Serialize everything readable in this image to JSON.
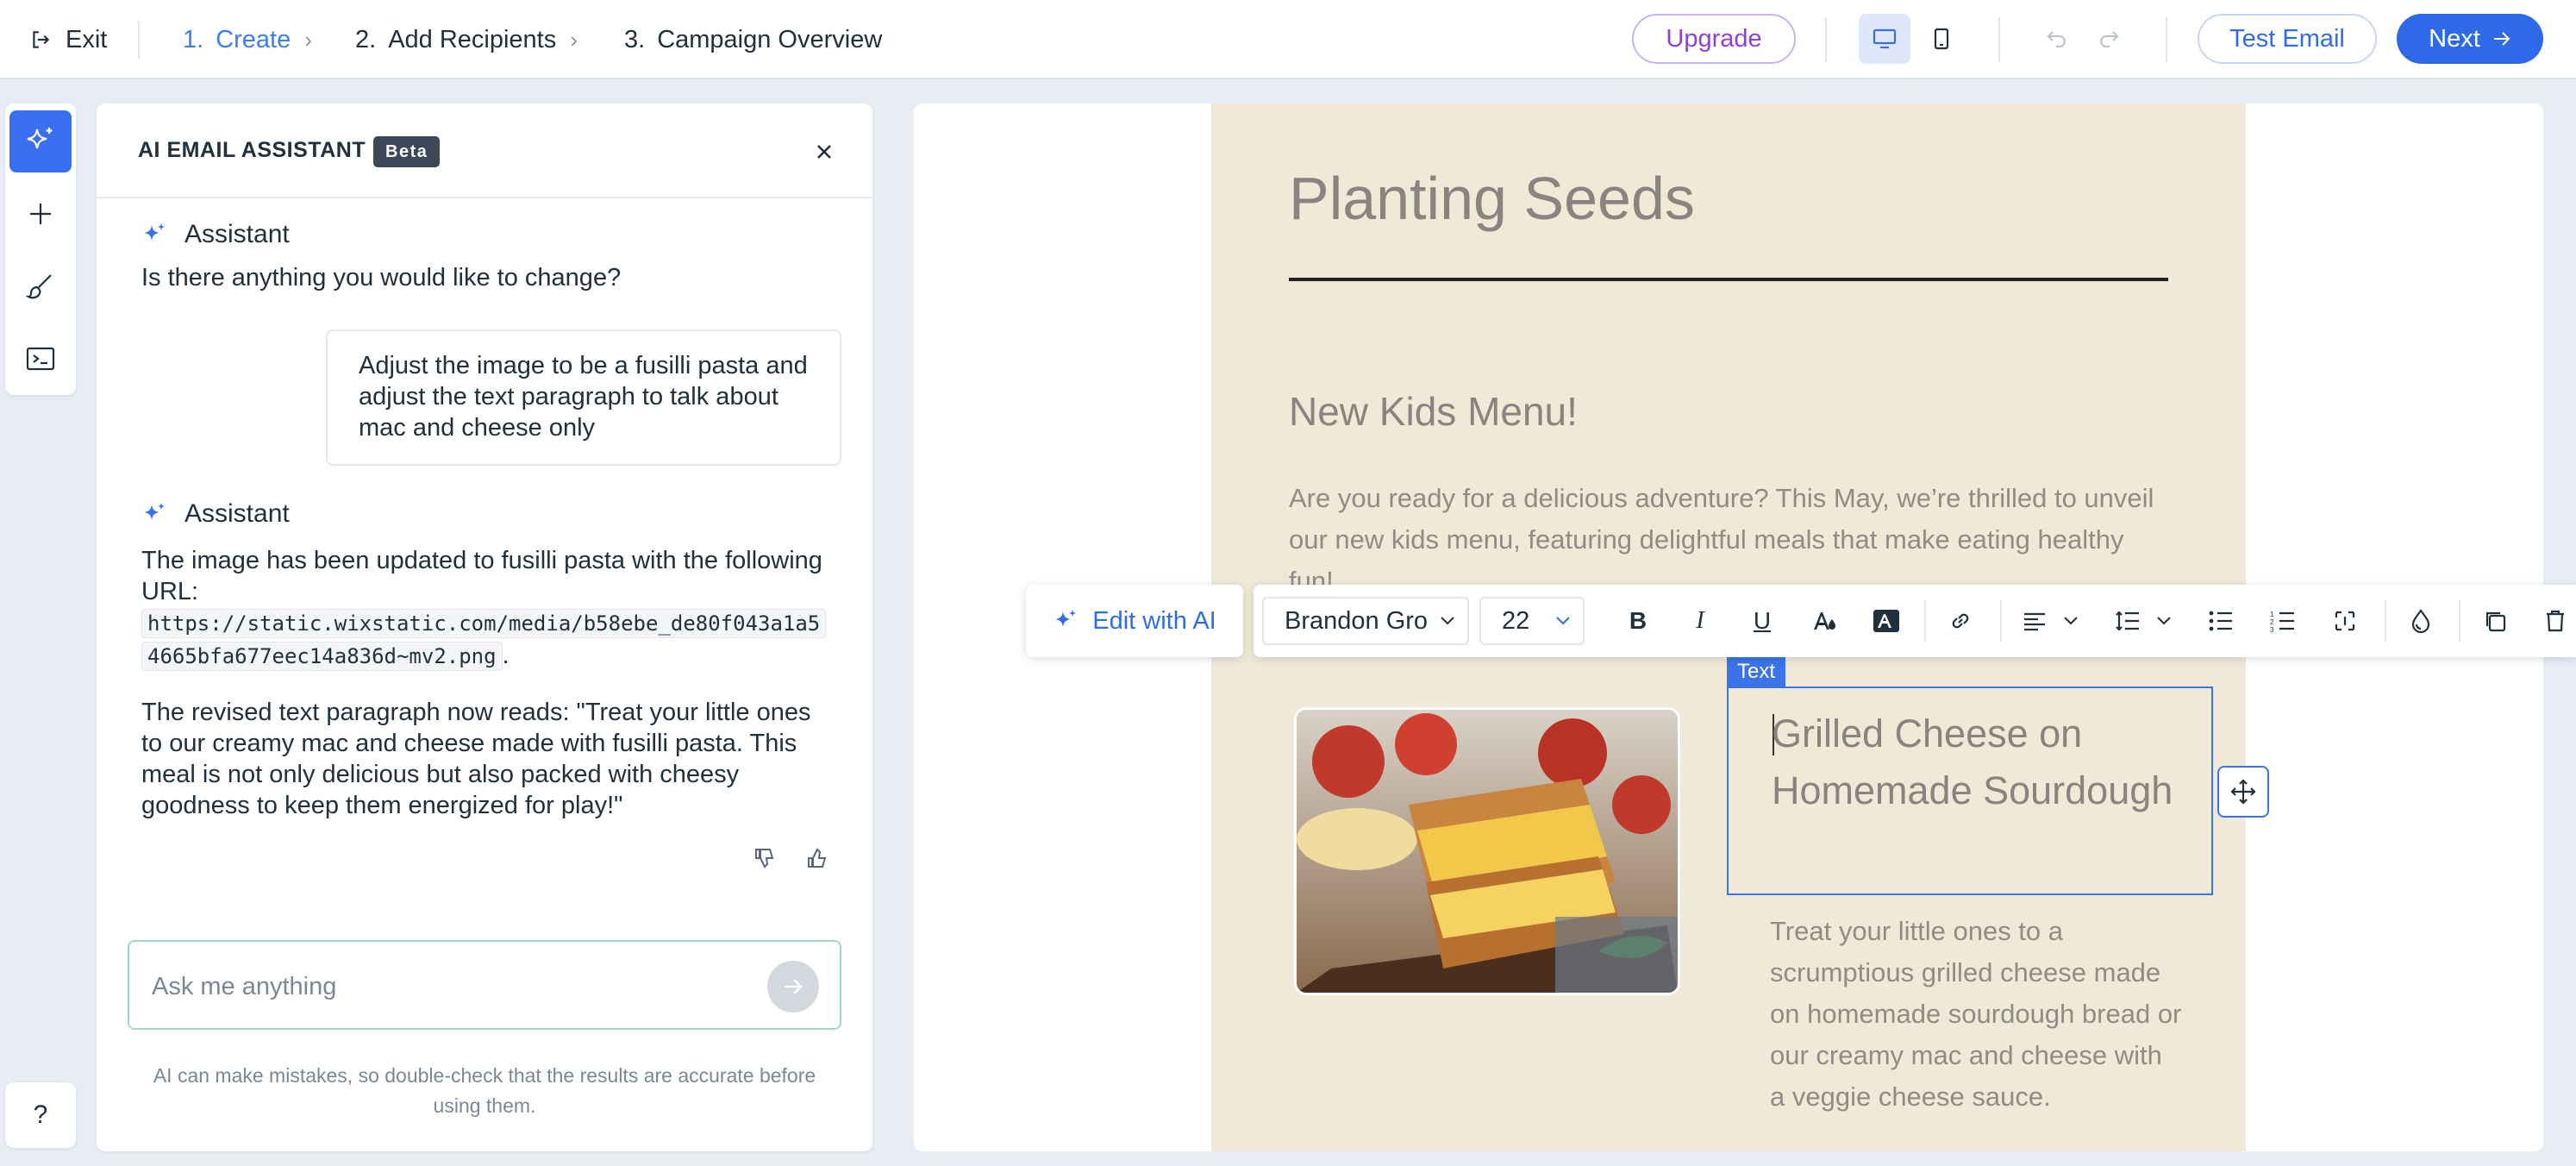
{
  "topbar": {
    "exit_label": "Exit",
    "steps": [
      {
        "num": "1.",
        "label": "Create"
      },
      {
        "num": "2.",
        "label": "Add Recipients"
      },
      {
        "num": "3.",
        "label": "Campaign Overview"
      }
    ],
    "upgrade_label": "Upgrade",
    "test_email_label": "Test Email",
    "next_label": "Next"
  },
  "panel": {
    "title": "AI EMAIL ASSISTANT",
    "badge": "Beta",
    "messages": {
      "assistant_name": "Assistant",
      "assistant_1": "Is there anything you would like to change?",
      "user_1": "Adjust the image to be a fusilli pasta and adjust the text paragraph to talk about mac and cheese only",
      "assistant_2_intro": "The image has been updated to fusilli pasta with the following URL:",
      "assistant_2_url_line1": "https://static.wixstatic.com/media/b58ebe_de80f043a1a5",
      "assistant_2_url_line2": "4665bfa677eec14a836d~mv2.png",
      "assistant_2_period": ".",
      "assistant_3": "The revised text paragraph now reads: \"Treat your little ones to our creamy mac and cheese made with fusilli pasta. This meal is not only delicious but also packed with cheesy goodness to keep them energized for play!\""
    },
    "input_placeholder": "Ask me anything",
    "disclaimer": "AI can make mistakes, so double-check that the results are accurate before using them."
  },
  "email": {
    "title": "Planting Seeds",
    "subtitle": "New Kids Menu!",
    "paragraph": "Are you ready for a delicious adventure? This May, we’re thrilled to unveil our new kids menu, featuring delightful meals that make eating healthy fun!",
    "text_badge": "Text",
    "item_title": "Grilled Cheese on Homemade Sourdough",
    "item_desc": "Treat your little ones to a scrumptious grilled cheese made on homemade sourdough bread or our creamy mac and cheese with a veggie cheese sauce."
  },
  "toolbar": {
    "edit_ai_label": "Edit with AI",
    "font": "Brandon Gro",
    "font_size": "22"
  },
  "colors": {
    "accent": "#2e69e8",
    "email_bg": "#f1e9d7",
    "upgrade_purple": "#8f3fe0"
  }
}
